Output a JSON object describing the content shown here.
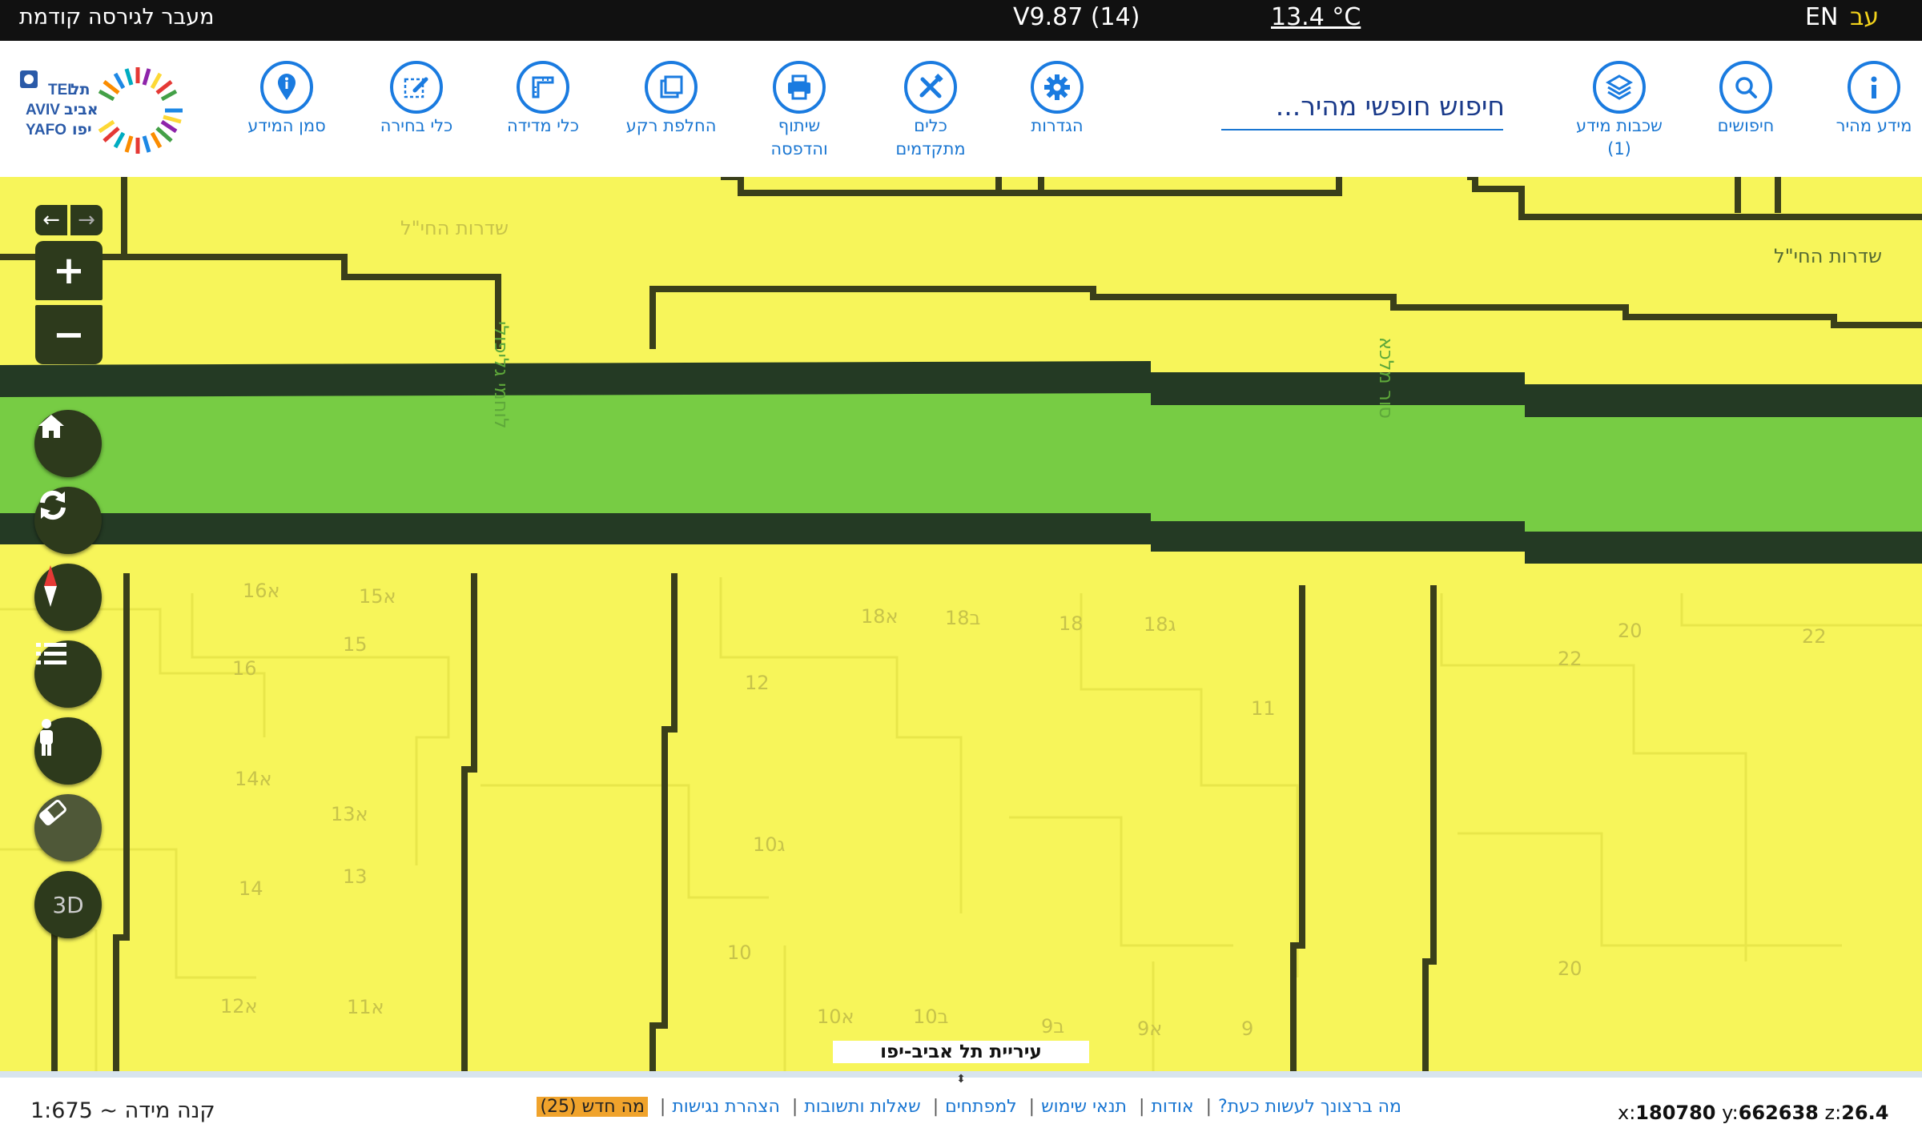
{
  "topbar": {
    "prev_version": "מעבר לגירסה קודמת",
    "version": "V9.87 (14)",
    "temperature": "13.4 °C",
    "lang_en": "EN",
    "lang_he": "עב"
  },
  "toolbar": {
    "search_placeholder": "חיפוש חופשי מהיר...",
    "tools": [
      {
        "name": "quick-info",
        "label": "מידע מהיר",
        "icon": "info-icon"
      },
      {
        "name": "searches",
        "label": "חיפושים",
        "icon": "magnifier-icon"
      },
      {
        "name": "info-layers",
        "label": "שכבות מידע",
        "sublabel": "(1)",
        "icon": "layers-icon"
      },
      {
        "name": "settings",
        "label": "הגדרות",
        "icon": "gear-icon"
      },
      {
        "name": "advanced-tools",
        "label": "כלים",
        "sublabel": "מתקדמים",
        "icon": "tools-icon"
      },
      {
        "name": "share-print",
        "label": "שיתוף",
        "sublabel": "והדפסה",
        "icon": "printer-icon"
      },
      {
        "name": "basemap",
        "label": "החלפת רקע",
        "icon": "basemap-icon"
      },
      {
        "name": "measure",
        "label": "כלי מדידה",
        "icon": "ruler-icon"
      },
      {
        "name": "select",
        "label": "כלי בחירה",
        "icon": "select-pencil-icon"
      },
      {
        "name": "marker",
        "label": "סמן המידע",
        "icon": "info-pin-icon"
      }
    ],
    "logo_text": [
      "TEL",
      "AVIV",
      "YAFO",
      "תל",
      "אביב",
      "יפו"
    ]
  },
  "map": {
    "street_labels": [
      "שדרות החי\"ל",
      "שדרות החי\"ל",
      "לוחמי גליפולי",
      "סור מלכא"
    ],
    "parcel_labels": [
      "16א",
      "15א",
      "15",
      "16",
      "18א",
      "18ב",
      "18",
      "18ג",
      "12",
      "11",
      "20",
      "22",
      "22",
      "14א",
      "13א",
      "14",
      "13",
      "10ג",
      "10",
      "10א",
      "10ב",
      "9ב",
      "9א",
      "9",
      "20",
      "12א",
      "11א"
    ],
    "city_label": "עיריית תל אביב-יפו",
    "controls": {
      "zoom_in": "+",
      "zoom_out": "−",
      "three_d": "3D"
    }
  },
  "bottombar": {
    "scale": "קנה מידה ~ 1:675",
    "links": [
      "מה ברצונך לעשות כעת?",
      "אודות",
      "תנאי שימוש",
      "למפתחים",
      "שאלות ותשובות",
      "הצהרת נגישות"
    ],
    "news": "מה חדש (25)",
    "coord_x_label": "x:",
    "coord_x": "180780",
    "coord_y_label": "y:",
    "coord_y": "662638",
    "coord_z_label": "z:",
    "coord_z": "26.4"
  },
  "colors": {
    "accent": "#1976d2",
    "map_yellow": "#f7f55a",
    "street_green": "#77cc44",
    "street_edge": "#243a24",
    "control_bg": "#2d3a1c"
  }
}
